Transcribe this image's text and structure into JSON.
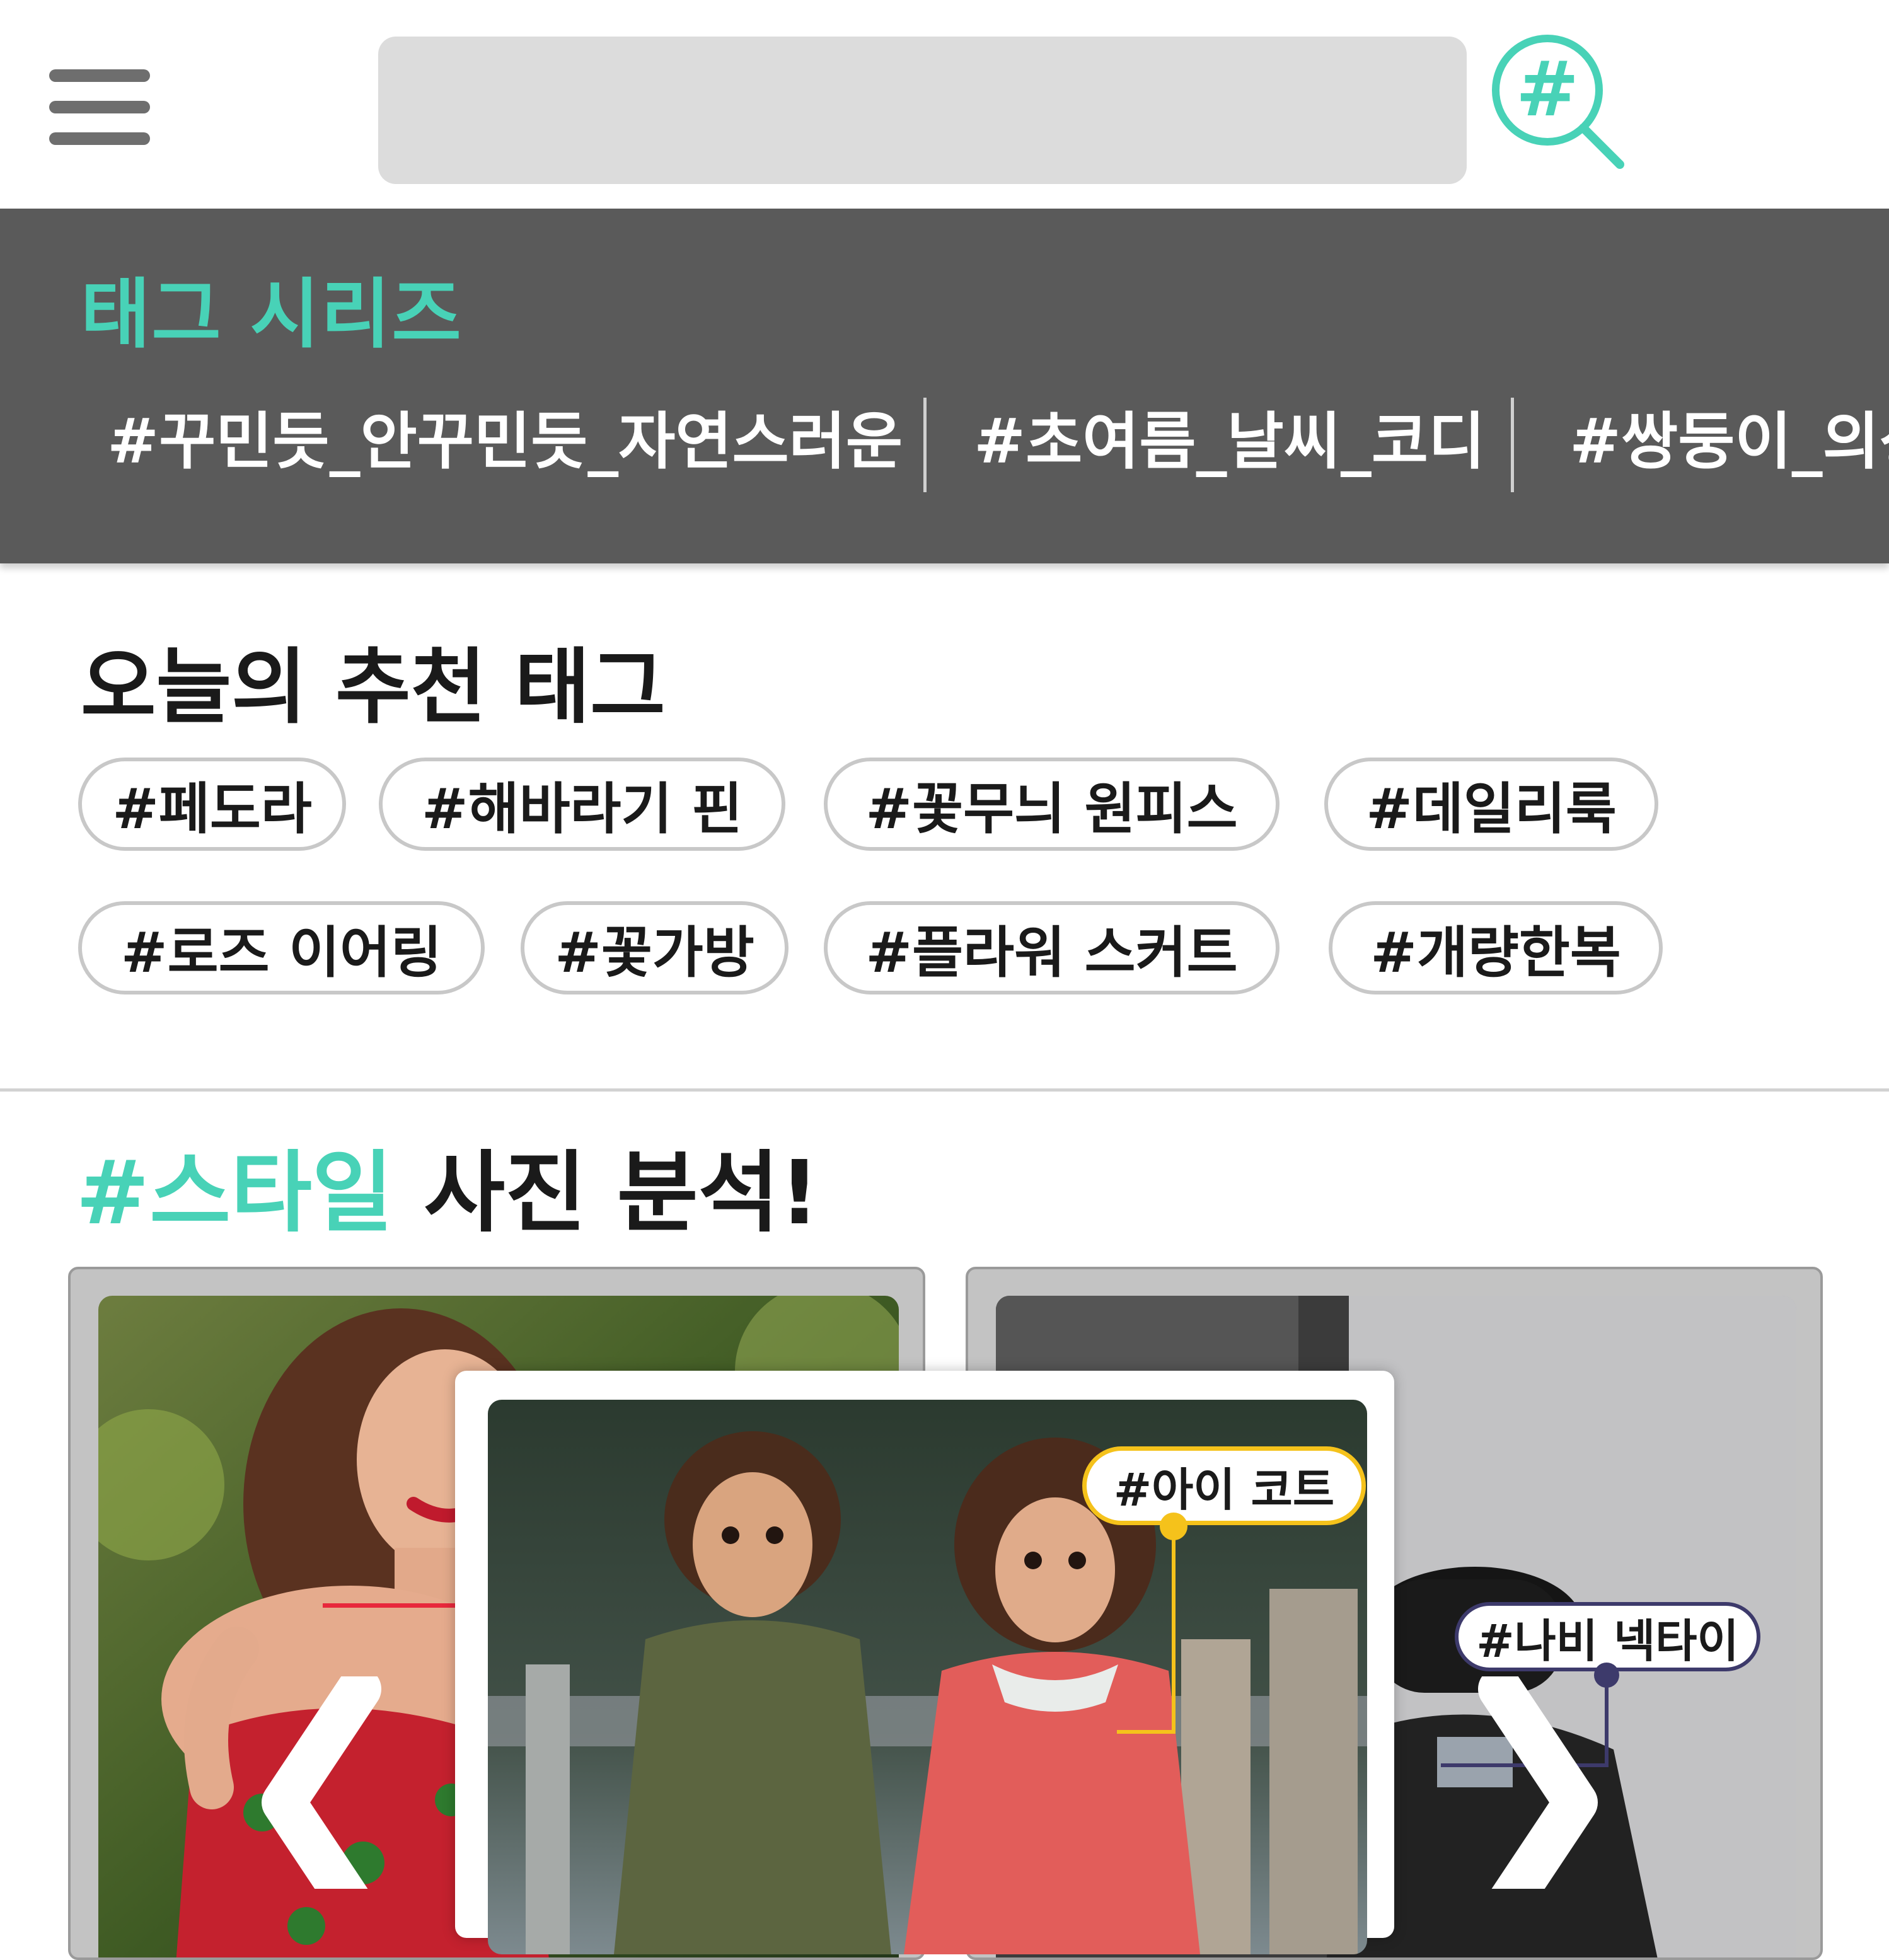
{
  "search": {
    "placeholder": ""
  },
  "series": {
    "title": "태그 시리즈",
    "items": [
      {
        "label": "#꾸민듯_안꾸민듯_자연스러운"
      },
      {
        "label": "#초여름_날씨_코디"
      },
      {
        "label": "#쌍둥이_의상"
      }
    ]
  },
  "recommended": {
    "title": "오늘의 추천 태그",
    "tags": [
      {
        "label": "#페도라"
      },
      {
        "label": "#해바라기 핀"
      },
      {
        "label": "#꽃무늬 원피스"
      },
      {
        "label": "#데일리룩"
      },
      {
        "label": "#로즈 이어링"
      },
      {
        "label": "#꽃가방"
      },
      {
        "label": "#플라워 스커트"
      },
      {
        "label": "#개량한복"
      }
    ]
  },
  "analysis": {
    "title_highlight": "#스타일",
    "title_rest": " 사진 분석!",
    "photo_tags": {
      "center": "#아이 코트",
      "right": "#나비 넥타이"
    }
  },
  "colors": {
    "accent": "#48d2b7",
    "band": "#5a5a5a",
    "chip_border": "#c8c8c8",
    "tag_yellow": "#f5c21b",
    "tag_navy": "#3d3a6b",
    "tag_red": "#e8283c"
  },
  "icons": {
    "menu": "hamburger-menu-icon",
    "search": "hashtag-search-icon",
    "prev": "chevron-left-icon",
    "next": "chevron-right-icon"
  }
}
